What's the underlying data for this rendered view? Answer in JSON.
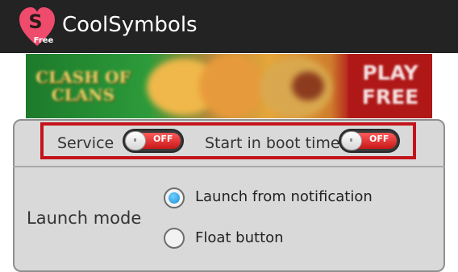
{
  "app": {
    "title": "CoolSymbols",
    "icon": {
      "name": "heart-s-logo-icon",
      "letter": "S",
      "sub": "Free",
      "color": "#ef4b6c"
    }
  },
  "ad_banner": {
    "game_logo": "CLASH OF CLANS",
    "cta_line1": "PLAY",
    "cta_line2": "FREE"
  },
  "settings": {
    "service": {
      "label": "Service",
      "state": "OFF"
    },
    "boot": {
      "label": "Start in boot time",
      "state": "OFF"
    },
    "launch_mode": {
      "label": "Launch mode",
      "options": [
        "Launch from notification",
        "Float button"
      ],
      "selected": "Launch from notification"
    }
  },
  "colors": {
    "actionbar": "#232323",
    "highlight": "#c3141b",
    "toggle_off": "#e53b3b",
    "radio_selected": "#1a8fd6"
  }
}
